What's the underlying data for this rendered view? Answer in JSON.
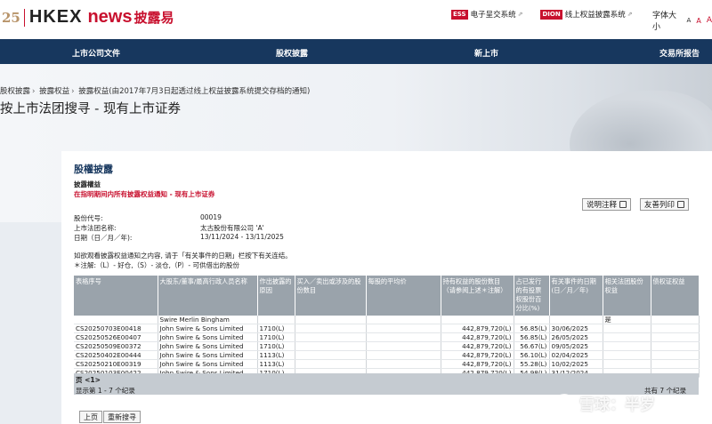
{
  "brand": {
    "anniv": "25",
    "hkex": "HKEX",
    "news": "news",
    "cn": "披露易"
  },
  "toplinks": [
    {
      "tag": "ESS",
      "label": "电子呈交系统"
    },
    {
      "tag": "DION",
      "label": "线上权益披露系统"
    }
  ],
  "font_size": {
    "label": "字体大小",
    "small": "A",
    "medium": "A",
    "large": "A"
  },
  "nav": [
    "上市公司文件",
    "股权披露",
    "新上市",
    "交易所报告"
  ],
  "breadcrumb": [
    "股权披露",
    "披露权益",
    "披露权益(由2017年7月3日起透过线上权益披露系统提交存档的通知)"
  ],
  "page_title": "按上市法团搜寻 - 现有上市证券",
  "section_title": "股權披露",
  "sub_title": "披露權益",
  "sub_title2": "在指明期间内所有披露权益通知 - 现有上市证券",
  "buttons": {
    "help": "说明注释",
    "print": "友善列印"
  },
  "info": {
    "code_label": "股份代号:",
    "code": "00019",
    "name_label": "上市法团名称:",
    "name": "太古股份有限公司 'A'",
    "date_label": "日期（日／月／年):",
    "date": "13/11/2024 - 13/11/2025"
  },
  "notes": [
    "如欲观看披露权益通知之内容, 请于「有关事件的日期」栏按下有关连结。",
    "＊注解:（L）- 好仓,（S）- 淡仓,（P）- 可供借出的股份"
  ],
  "table": {
    "headers": [
      "表格序号",
      "大股东/董事/最高行政人员名称",
      "作出披露的原因",
      "买入／卖出或涉及的股份数目",
      "每股的平均价",
      "持有权益的股份数目（请参阅上述＊注解）",
      "占已发行的有投票权股份百分比(%)",
      "有关事件的日期(日／月／年)",
      "相关法团股份权益",
      "债权证权益"
    ],
    "group_row": {
      "name": "Swire Merlin Bingham",
      "related": "是"
    },
    "rows": [
      {
        "form": "CS20250703E00418",
        "name": "John Swire & Sons Limited",
        "reason": "1710(L)",
        "shares": "442,879,720(L)",
        "pct": "56.85(L)",
        "date": "30/06/2025"
      },
      {
        "form": "CS20250526E00407",
        "name": "John Swire & Sons Limited",
        "reason": "1710(L)",
        "shares": "442,879,720(L)",
        "pct": "56.85(L)",
        "date": "26/05/2025"
      },
      {
        "form": "CS20250509E00372",
        "name": "John Swire & Sons Limited",
        "reason": "1710(L)",
        "shares": "442,879,720(L)",
        "pct": "56.67(L)",
        "date": "09/05/2025"
      },
      {
        "form": "CS20250402E00444",
        "name": "John Swire & Sons Limited",
        "reason": "1113(L)",
        "shares": "442,879,720(L)",
        "pct": "56.10(L)",
        "date": "02/04/2025"
      },
      {
        "form": "CS20250210E00319",
        "name": "John Swire & Sons Limited",
        "reason": "1113(L)",
        "shares": "442,879,720(L)",
        "pct": "55.28(L)",
        "date": "10/02/2025"
      },
      {
        "form": "CS20250103E00422",
        "name": "John Swire & Sons Limited",
        "reason": "1710(L)",
        "shares": "442,879,720(L)",
        "pct": "54.98(L)",
        "date": "31/12/2024"
      }
    ]
  },
  "pager": {
    "page": "页 <1>",
    "showing": "显示第 1 - 7 个纪录",
    "total": "共有 7 个纪录"
  },
  "bottom_buttons": {
    "prev": "上页",
    "new_search": "重新搜寻"
  },
  "watermark": "雪球：半岁"
}
